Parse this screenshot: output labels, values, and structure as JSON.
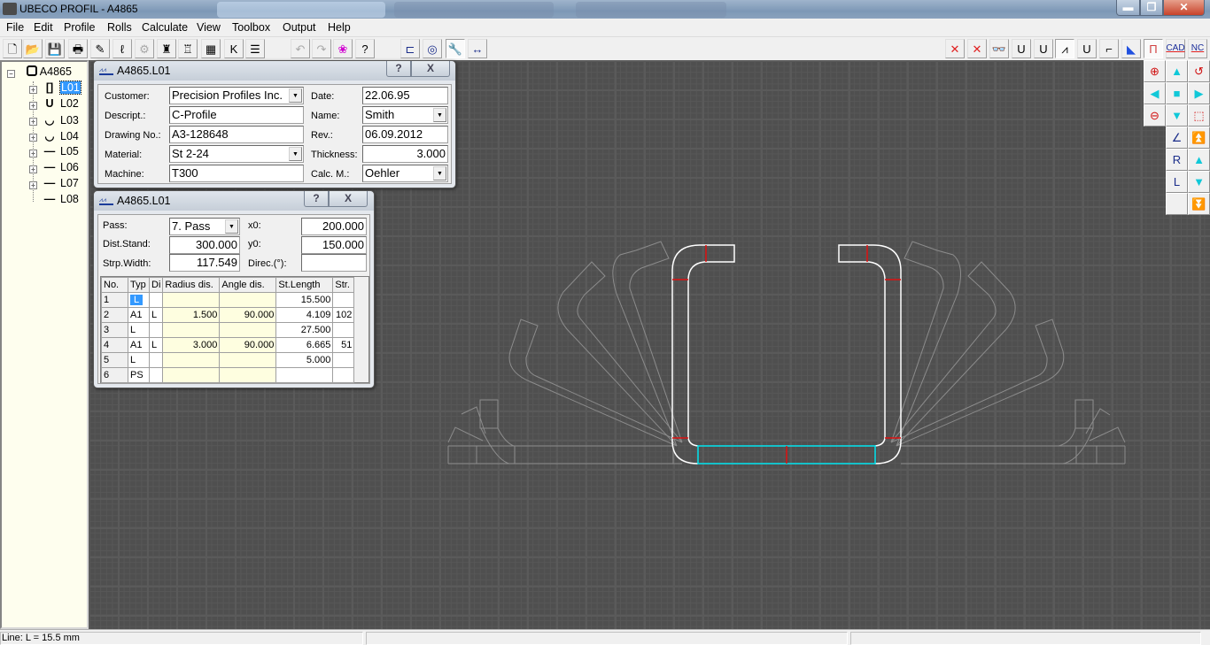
{
  "window": {
    "title": "UBECO PROFIL - A4865",
    "minimize_icon": "minimize-icon",
    "maximize_icon": "restore-icon",
    "close_icon": "close-icon"
  },
  "menu": [
    "File",
    "Edit",
    "Profile",
    "Rolls",
    "Calculate",
    "View",
    "Toolbox",
    "Output",
    "Help"
  ],
  "toolbar_left": [
    {
      "name": "new-file-icon",
      "glyph": "🗋"
    },
    {
      "name": "open-folder-icon",
      "glyph": "📂"
    },
    {
      "name": "save-icon",
      "glyph": "💾"
    },
    {
      "name": "print-icon",
      "glyph": "🖶"
    },
    {
      "name": "profile-edit-icon",
      "glyph": "✎"
    },
    {
      "name": "bend-curve-icon",
      "glyph": "ℓ"
    },
    {
      "name": "robot-icon",
      "glyph": "⚙"
    },
    {
      "name": "roll-tool-icon",
      "glyph": "♜"
    },
    {
      "name": "roll-stand-icon",
      "glyph": "♖"
    },
    {
      "name": "window-grid-icon",
      "glyph": "▦"
    },
    {
      "name": "flower-pattern-icon",
      "glyph": "K"
    },
    {
      "name": "table-lines-icon",
      "glyph": "☰"
    },
    {
      "name": "undo-icon",
      "glyph": "↶"
    },
    {
      "name": "redo-icon",
      "glyph": "↷"
    },
    {
      "name": "balloon-icon",
      "glyph": "❀"
    },
    {
      "name": "help-context-icon",
      "glyph": "?"
    },
    {
      "name": "profile-view-icon",
      "glyph": "⊏"
    },
    {
      "name": "photo-view-icon",
      "glyph": "◎"
    },
    {
      "name": "tool-view-icon",
      "glyph": "🔧"
    },
    {
      "name": "dimension-view-icon",
      "glyph": "↔"
    }
  ],
  "toolbar_right": [
    {
      "name": "delete-grid-icon",
      "glyph": "✕"
    },
    {
      "name": "delete-dimension-icon",
      "glyph": "✕"
    },
    {
      "name": "glasses-icon",
      "glyph": "👓"
    },
    {
      "name": "u-profile-icon",
      "glyph": "U"
    },
    {
      "name": "u-strips-icon",
      "glyph": "U"
    },
    {
      "name": "flower-view-icon",
      "glyph": "⩘"
    },
    {
      "name": "roll-u-icon",
      "glyph": "U"
    },
    {
      "name": "gun-icon",
      "glyph": "⌐"
    },
    {
      "name": "color-3d-icon",
      "glyph": "◣"
    },
    {
      "name": "frame-icon",
      "glyph": "Π"
    },
    {
      "name": "cad-export-icon",
      "glyph": "CAD"
    },
    {
      "name": "nc-export-icon",
      "glyph": "NC"
    }
  ],
  "tree": {
    "root": "A4865",
    "items": [
      {
        "label": "L01",
        "selected": true
      },
      {
        "label": "L02"
      },
      {
        "label": "L03"
      },
      {
        "label": "L04"
      },
      {
        "label": "L05"
      },
      {
        "label": "L06"
      },
      {
        "label": "L07"
      },
      {
        "label": "L08"
      }
    ]
  },
  "header_dialog": {
    "title": "A4865.L01",
    "help": "?",
    "close": "X",
    "fields": {
      "customer_label": "Customer:",
      "customer": "Precision Profiles Inc.",
      "description_label": "Descript.:",
      "description": "C-Profile",
      "drawing_label": "Drawing No.:",
      "drawing": "A3-128648",
      "material_label": "Material:",
      "material": "St 2-24",
      "machine_label": "Machine:",
      "machine": "T300",
      "date_label": "Date:",
      "date": "22.06.95",
      "name_label": "Name:",
      "name": "Smith",
      "rev_label": "Rev.:",
      "rev": "06.09.2012",
      "thickness_label": "Thickness:",
      "thickness": "3.000",
      "calc_label": "Calc. M.:",
      "calc": "Oehler"
    }
  },
  "pass_dialog": {
    "title": "A4865.L01",
    "help": "?",
    "close": "X",
    "pass_label": "Pass:",
    "pass": "7. Pass",
    "dist_label": "Dist.Stand:",
    "dist": "300.000",
    "strip_label": "Strp.Width:",
    "strip": "117.549",
    "x0_label": "x0:",
    "x0": "200.000",
    "y0_label": "y0:",
    "y0": "150.000",
    "direc_label": "Direc.(°):",
    "direc": "",
    "columns": [
      "No.",
      "Typ",
      "Di",
      "Radius dis.",
      "Angle dis.",
      "St.Length",
      "Str."
    ],
    "rows": [
      [
        "1",
        "L",
        "",
        "",
        "",
        "15.500",
        ""
      ],
      [
        "2",
        "A1",
        "L",
        "1.500",
        "90.000",
        "4.109",
        "102"
      ],
      [
        "3",
        "L",
        "",
        "",
        "",
        "27.500",
        ""
      ],
      [
        "4",
        "A1",
        "L",
        "3.000",
        "90.000",
        "6.665",
        "51"
      ],
      [
        "5",
        "L",
        "",
        "",
        "",
        "5.000",
        ""
      ],
      [
        "6",
        "PS",
        "",
        "",
        "",
        "",
        ""
      ]
    ]
  },
  "right_tools": [
    {
      "name": "zoom-in-icon",
      "glyph": "⊕"
    },
    {
      "name": "pan-up-icon",
      "glyph": "▲"
    },
    {
      "name": "zoom-previous-icon",
      "glyph": "↺"
    },
    {
      "name": "pan-left-icon",
      "glyph": "◀"
    },
    {
      "name": "fit-view-icon",
      "glyph": "■"
    },
    {
      "name": "pan-right-icon",
      "glyph": "▶"
    },
    {
      "name": "zoom-out-icon",
      "glyph": "⊖"
    },
    {
      "name": "pan-down-icon",
      "glyph": "▼"
    },
    {
      "name": "zoom-window-icon",
      "glyph": "⬚"
    },
    {
      "name": "angle-dimension-icon",
      "glyph": "∠"
    },
    {
      "name": "first-pass-icon",
      "glyph": "⏫"
    },
    {
      "name": "radius-dimension-icon",
      "glyph": "R"
    },
    {
      "name": "previous-pass-icon",
      "glyph": "▲"
    },
    {
      "name": "length-dimension-icon",
      "glyph": "L"
    },
    {
      "name": "next-pass-icon",
      "glyph": "▼"
    },
    {
      "name": "last-pass-icon",
      "glyph": "⏬"
    }
  ],
  "status": {
    "text": "Line: L = 15.5 mm",
    "pane2": "",
    "pane3": ""
  },
  "colors": {
    "profile": "#ffffff",
    "selected_segment": "#00e5f0",
    "marker": "#e01010",
    "previous_passes": "#8c8c8c",
    "canvas_bg": "#4f4f4f",
    "tree_bg": "#fefeee"
  }
}
